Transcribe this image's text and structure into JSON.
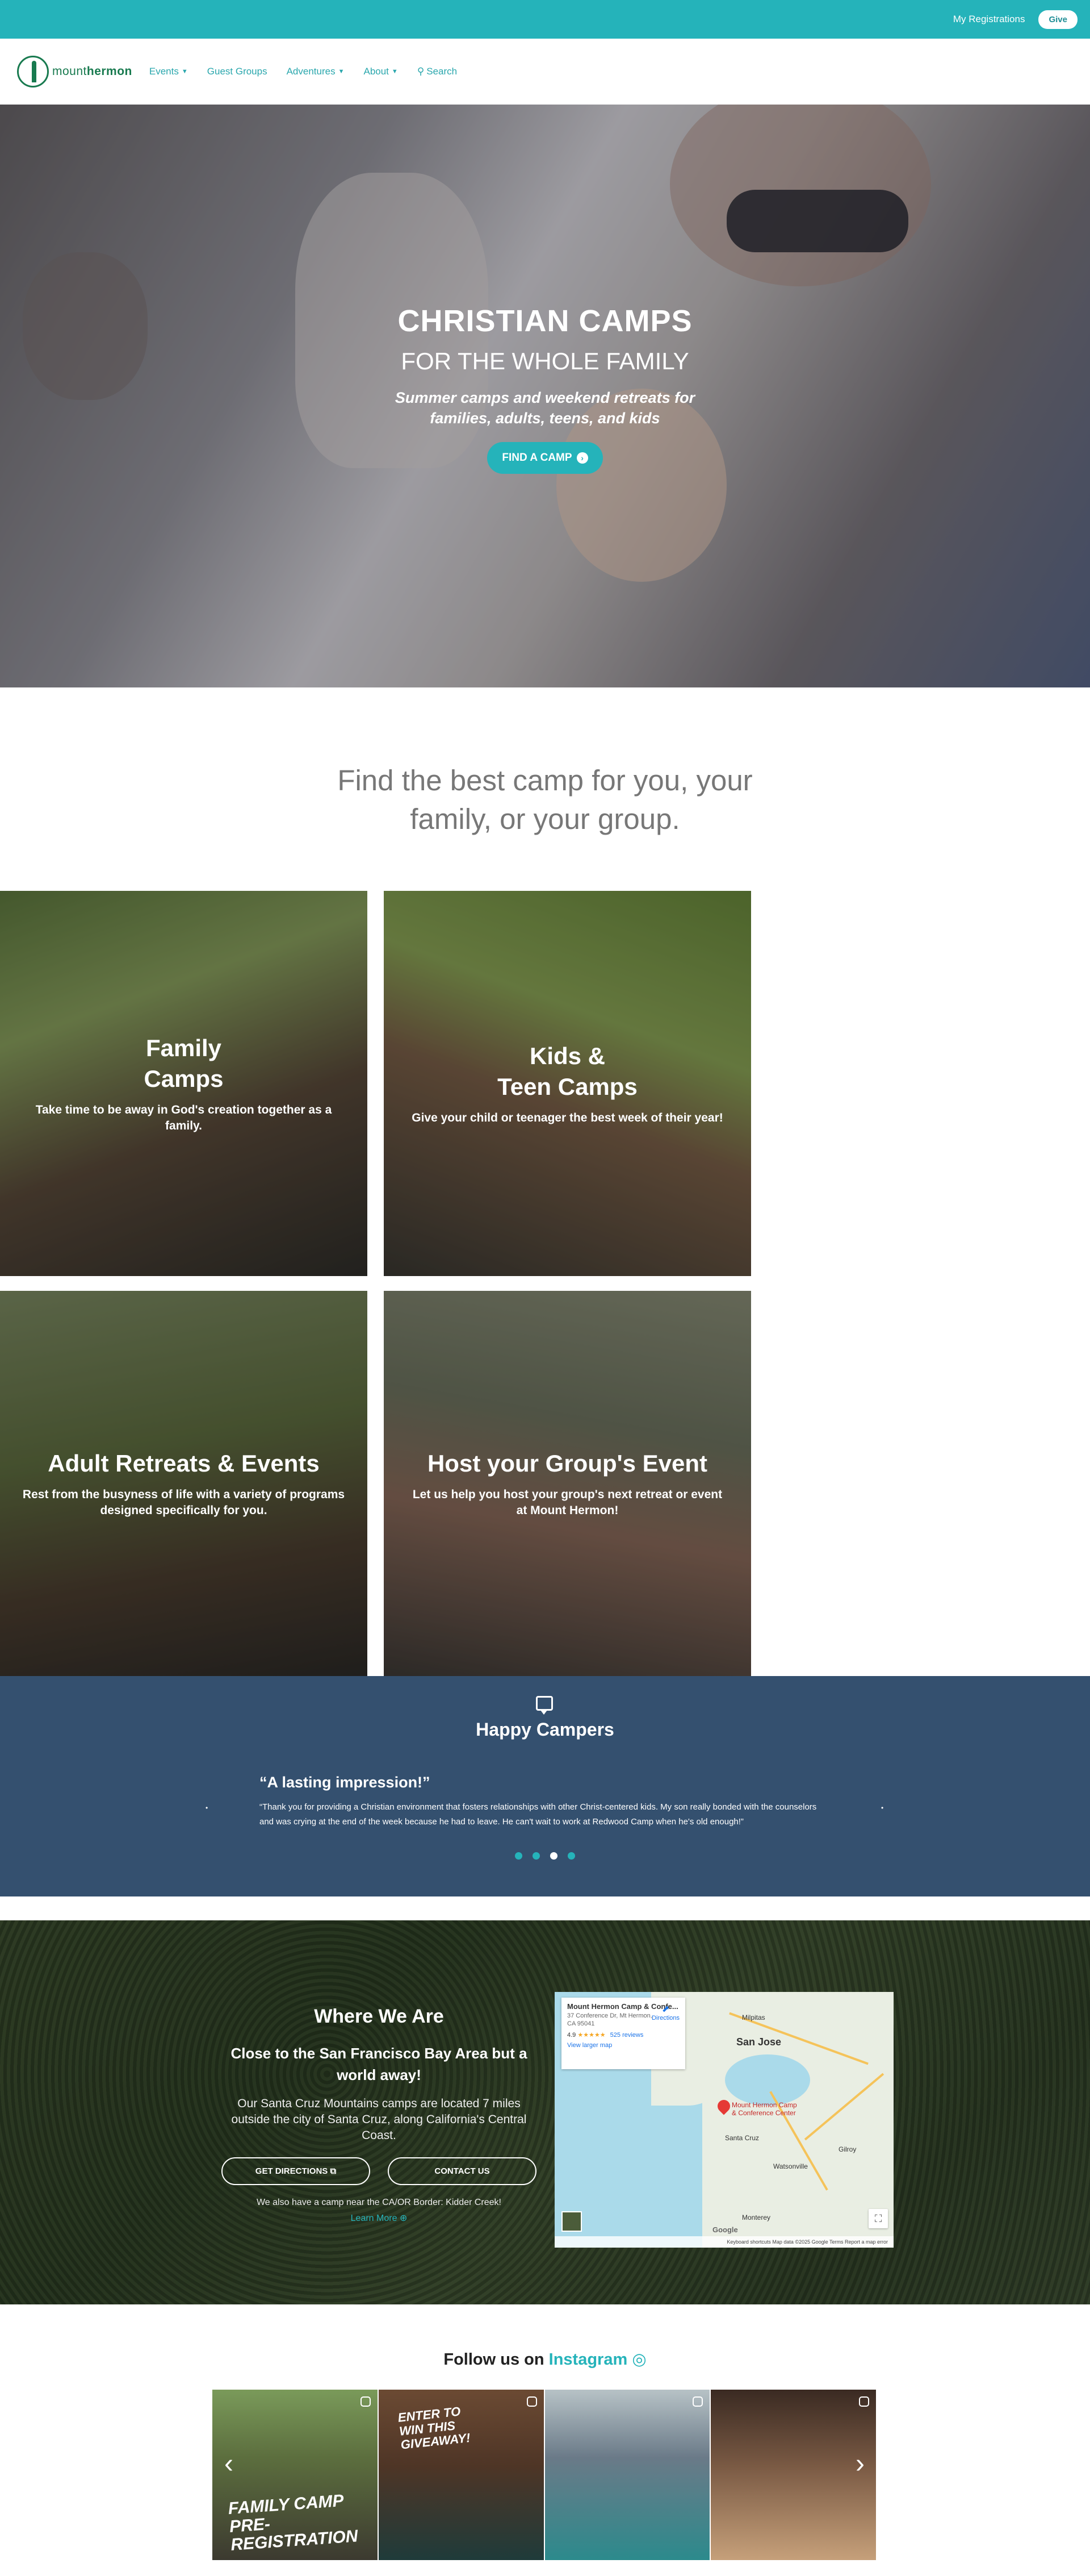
{
  "topbar": {
    "registrations": "My Registrations",
    "give": "Give",
    "color": "#25b3ba"
  },
  "nav": {
    "logo_light": "mount",
    "logo_bold": "hermon",
    "items": [
      {
        "label": "Events",
        "icon": "chevron-down-icon"
      },
      {
        "label": "Guest Groups"
      },
      {
        "label": "Adventures",
        "icon": "chevron-down-icon"
      },
      {
        "label": "About",
        "icon": "chevron-down-icon"
      },
      {
        "label": "Search",
        "icon": "search-icon"
      }
    ]
  },
  "hero": {
    "title": "CHRISTIAN CAMPS",
    "subtitle": "FOR THE WHOLE FAMILY",
    "description_line1": "Summer camps and weekend retreats for",
    "description_line2": "families, adults, teens, and kids",
    "button": "FIND A CAMP"
  },
  "tagline": "Find the best camp for you, your family, or your group.",
  "cards": [
    {
      "title_line1": "Family",
      "title_line2": "Camps",
      "text": "Take time to be away in God's creation together as a family."
    },
    {
      "title_line1": "Kids &",
      "title_line2": "Teen Camps",
      "text": "Give your child or teenager the best week of their year!"
    },
    {
      "title_line1": "Adult Retreats & Events",
      "text": "Rest from the busyness of life with a variety of programs designed specifically for you."
    },
    {
      "title_line1": "Host your Group's Event",
      "text": "Let us help you host your group's next retreat or event at Mount Hermon!"
    }
  ],
  "testimonials": {
    "heading": "Happy Campers",
    "quote_title": "“A lasting impression!”",
    "quote": "“Thank you for providing a Christian environment that fosters relationships with other Christ-centered kids. My son really bonded with the counselors and was crying at the end of the week because he had to leave. He can't wait to work at Redwood Camp when he's old enough!”",
    "active_dot": 3,
    "dot_count": 4
  },
  "where": {
    "heading": "Where We Are",
    "subheading": "Close to the San Francisco Bay Area but a world away!",
    "text": "Our Santa Cruz Mountains camps are located 7 miles outside the city of Santa Cruz, along California's Central Coast.",
    "directions_button": "GET DIRECTIONS",
    "contact_button": "CONTACT US",
    "also": "We also have a camp near the CA/OR Border: Kidder Creek!",
    "learn_more": "Learn More"
  },
  "map": {
    "place_name": "Mount Hermon Camp & Confe...",
    "address": "37 Conference Dr, Mt Hermon, CA 95041",
    "rating": "4.9",
    "stars": "★★★★★",
    "reviews": "525 reviews",
    "view_larger": "View larger map",
    "directions": "Directions",
    "pin_label": "Mount Hermon Camp & Conference Center",
    "city_sanjose": "San Jose",
    "city_santacruz": "Santa Cruz",
    "city_watsonville": "Watsonville",
    "city_monterey": "Monterey",
    "city_gilroy": "Gilroy",
    "city_milpitas": "Milpitas",
    "footer": "Keyboard shortcuts   Map data ©2025 Google   Terms   Report a map error",
    "google": "Google"
  },
  "instagram": {
    "prefix": "Follow us on",
    "name": "Instagram",
    "tiles": [
      {
        "caption": "FAMILY CAMP PRE-REGISTRATION"
      },
      {
        "caption": "ENTER TO WIN THIS GIVEAWAY!"
      },
      {
        "caption": ""
      },
      {
        "caption": ""
      }
    ]
  }
}
